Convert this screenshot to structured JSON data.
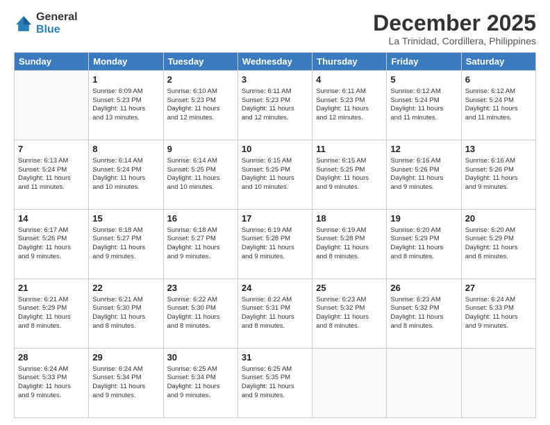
{
  "logo": {
    "general": "General",
    "blue": "Blue"
  },
  "header": {
    "month_year": "December 2025",
    "location": "La Trinidad, Cordillera, Philippines"
  },
  "days_of_week": [
    "Sunday",
    "Monday",
    "Tuesday",
    "Wednesday",
    "Thursday",
    "Friday",
    "Saturday"
  ],
  "weeks": [
    [
      {
        "day": "",
        "info": ""
      },
      {
        "day": "1",
        "info": "Sunrise: 6:09 AM\nSunset: 5:23 PM\nDaylight: 11 hours\nand 13 minutes."
      },
      {
        "day": "2",
        "info": "Sunrise: 6:10 AM\nSunset: 5:23 PM\nDaylight: 11 hours\nand 12 minutes."
      },
      {
        "day": "3",
        "info": "Sunrise: 6:11 AM\nSunset: 5:23 PM\nDaylight: 11 hours\nand 12 minutes."
      },
      {
        "day": "4",
        "info": "Sunrise: 6:11 AM\nSunset: 5:23 PM\nDaylight: 11 hours\nand 12 minutes."
      },
      {
        "day": "5",
        "info": "Sunrise: 6:12 AM\nSunset: 5:24 PM\nDaylight: 11 hours\nand 11 minutes."
      },
      {
        "day": "6",
        "info": "Sunrise: 6:12 AM\nSunset: 5:24 PM\nDaylight: 11 hours\nand 11 minutes."
      }
    ],
    [
      {
        "day": "7",
        "info": "Sunrise: 6:13 AM\nSunset: 5:24 PM\nDaylight: 11 hours\nand 11 minutes."
      },
      {
        "day": "8",
        "info": "Sunrise: 6:14 AM\nSunset: 5:24 PM\nDaylight: 11 hours\nand 10 minutes."
      },
      {
        "day": "9",
        "info": "Sunrise: 6:14 AM\nSunset: 5:25 PM\nDaylight: 11 hours\nand 10 minutes."
      },
      {
        "day": "10",
        "info": "Sunrise: 6:15 AM\nSunset: 5:25 PM\nDaylight: 11 hours\nand 10 minutes."
      },
      {
        "day": "11",
        "info": "Sunrise: 6:15 AM\nSunset: 5:25 PM\nDaylight: 11 hours\nand 9 minutes."
      },
      {
        "day": "12",
        "info": "Sunrise: 6:16 AM\nSunset: 5:26 PM\nDaylight: 11 hours\nand 9 minutes."
      },
      {
        "day": "13",
        "info": "Sunrise: 6:16 AM\nSunset: 5:26 PM\nDaylight: 11 hours\nand 9 minutes."
      }
    ],
    [
      {
        "day": "14",
        "info": "Sunrise: 6:17 AM\nSunset: 5:26 PM\nDaylight: 11 hours\nand 9 minutes."
      },
      {
        "day": "15",
        "info": "Sunrise: 6:18 AM\nSunset: 5:27 PM\nDaylight: 11 hours\nand 9 minutes."
      },
      {
        "day": "16",
        "info": "Sunrise: 6:18 AM\nSunset: 5:27 PM\nDaylight: 11 hours\nand 9 minutes."
      },
      {
        "day": "17",
        "info": "Sunrise: 6:19 AM\nSunset: 5:28 PM\nDaylight: 11 hours\nand 9 minutes."
      },
      {
        "day": "18",
        "info": "Sunrise: 6:19 AM\nSunset: 5:28 PM\nDaylight: 11 hours\nand 8 minutes."
      },
      {
        "day": "19",
        "info": "Sunrise: 6:20 AM\nSunset: 5:29 PM\nDaylight: 11 hours\nand 8 minutes."
      },
      {
        "day": "20",
        "info": "Sunrise: 6:20 AM\nSunset: 5:29 PM\nDaylight: 11 hours\nand 8 minutes."
      }
    ],
    [
      {
        "day": "21",
        "info": "Sunrise: 6:21 AM\nSunset: 5:29 PM\nDaylight: 11 hours\nand 8 minutes."
      },
      {
        "day": "22",
        "info": "Sunrise: 6:21 AM\nSunset: 5:30 PM\nDaylight: 11 hours\nand 8 minutes."
      },
      {
        "day": "23",
        "info": "Sunrise: 6:22 AM\nSunset: 5:30 PM\nDaylight: 11 hours\nand 8 minutes."
      },
      {
        "day": "24",
        "info": "Sunrise: 6:22 AM\nSunset: 5:31 PM\nDaylight: 11 hours\nand 8 minutes."
      },
      {
        "day": "25",
        "info": "Sunrise: 6:23 AM\nSunset: 5:32 PM\nDaylight: 11 hours\nand 8 minutes."
      },
      {
        "day": "26",
        "info": "Sunrise: 6:23 AM\nSunset: 5:32 PM\nDaylight: 11 hours\nand 8 minutes."
      },
      {
        "day": "27",
        "info": "Sunrise: 6:24 AM\nSunset: 5:33 PM\nDaylight: 11 hours\nand 9 minutes."
      }
    ],
    [
      {
        "day": "28",
        "info": "Sunrise: 6:24 AM\nSunset: 5:33 PM\nDaylight: 11 hours\nand 9 minutes."
      },
      {
        "day": "29",
        "info": "Sunrise: 6:24 AM\nSunset: 5:34 PM\nDaylight: 11 hours\nand 9 minutes."
      },
      {
        "day": "30",
        "info": "Sunrise: 6:25 AM\nSunset: 5:34 PM\nDaylight: 11 hours\nand 9 minutes."
      },
      {
        "day": "31",
        "info": "Sunrise: 6:25 AM\nSunset: 5:35 PM\nDaylight: 11 hours\nand 9 minutes."
      },
      {
        "day": "",
        "info": ""
      },
      {
        "day": "",
        "info": ""
      },
      {
        "day": "",
        "info": ""
      }
    ]
  ]
}
